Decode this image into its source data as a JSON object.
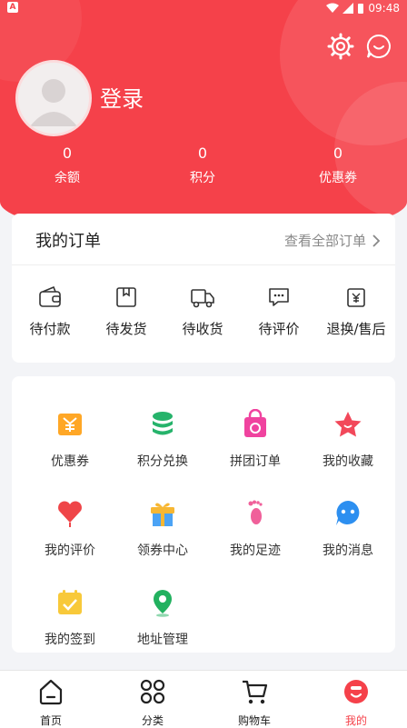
{
  "status_bar": {
    "time": "09:48"
  },
  "profile": {
    "login_label": "登录"
  },
  "stats": [
    {
      "value": "0",
      "label": "余额"
    },
    {
      "value": "0",
      "label": "积分"
    },
    {
      "value": "0",
      "label": "优惠券"
    }
  ],
  "orders": {
    "title": "我的订单",
    "view_all": "查看全部订单",
    "items": [
      {
        "label": "待付款",
        "icon": "wallet-icon"
      },
      {
        "label": "待发货",
        "icon": "package-icon"
      },
      {
        "label": "待收货",
        "icon": "truck-icon"
      },
      {
        "label": "待评价",
        "icon": "comment-icon"
      },
      {
        "label": "退换/售后",
        "icon": "refund-icon"
      }
    ]
  },
  "services": [
    {
      "label": "优惠券",
      "icon": "coupon-icon"
    },
    {
      "label": "积分兑换",
      "icon": "coins-icon"
    },
    {
      "label": "拼团订单",
      "icon": "group-bag-icon"
    },
    {
      "label": "我的收藏",
      "icon": "star-icon"
    },
    {
      "label": "我的评价",
      "icon": "heart-icon"
    },
    {
      "label": "领券中心",
      "icon": "gift-icon"
    },
    {
      "label": "我的足迹",
      "icon": "footprint-icon"
    },
    {
      "label": "我的消息",
      "icon": "message-icon"
    },
    {
      "label": "我的签到",
      "icon": "calendar-icon"
    },
    {
      "label": "地址管理",
      "icon": "location-icon"
    }
  ],
  "tabbar": [
    {
      "label": "首页",
      "icon": "home-icon"
    },
    {
      "label": "分类",
      "icon": "category-icon"
    },
    {
      "label": "购物车",
      "icon": "cart-icon"
    },
    {
      "label": "我的",
      "icon": "profile-icon"
    }
  ],
  "colors": {
    "accent": "#f5414a",
    "background": "#f3f4f7"
  }
}
